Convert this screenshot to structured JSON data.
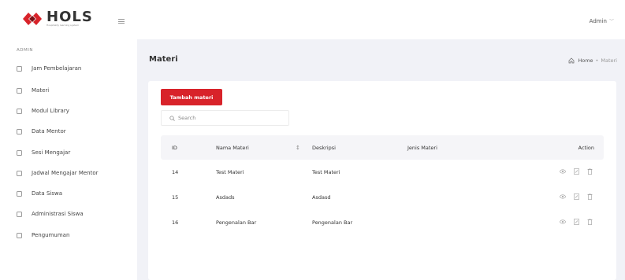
{
  "app": {
    "logo_name": "HOLS",
    "logo_tagline": "Hospitality learning system",
    "user_menu": "Admin"
  },
  "sidebar": {
    "section_label": "ADMIN",
    "items": [
      {
        "label": "Jam Pembelajaran"
      },
      {
        "label": "Materi"
      },
      {
        "label": "Modul Library"
      },
      {
        "label": "Data Mentor"
      },
      {
        "label": "Sesi Mengajar"
      },
      {
        "label": "Jadwal Mengajar Mentor"
      },
      {
        "label": "Data Siswa"
      },
      {
        "label": "Administrasi Siswa"
      },
      {
        "label": "Pengumuman"
      }
    ]
  },
  "page": {
    "title": "Materi",
    "breadcrumb": {
      "home": "Home",
      "separator": "•",
      "current": "Materi"
    }
  },
  "toolbar": {
    "add_label": "Tambah materi",
    "search_placeholder": "Search"
  },
  "table": {
    "columns": {
      "id": "ID",
      "nama": "Nama Materi",
      "deskripsi": "Deskripsi",
      "jenis": "Jenis Materi",
      "action": "Action"
    },
    "rows": [
      {
        "id": "14",
        "nama": "Test Materi",
        "deskripsi": "Test Materi",
        "jenis": ""
      },
      {
        "id": "15",
        "nama": "Asdads",
        "deskripsi": "Asdasd",
        "jenis": ""
      },
      {
        "id": "16",
        "nama": "Pengenalan Bar",
        "deskripsi": "Pengenalan Bar",
        "jenis": ""
      }
    ],
    "row_actions": [
      "eye-icon",
      "edit-icon",
      "trash-icon"
    ]
  },
  "colors": {
    "brand": "#d8232a",
    "content_bg": "#f1f2f7",
    "header_row_bg": "#f5f5f8"
  }
}
